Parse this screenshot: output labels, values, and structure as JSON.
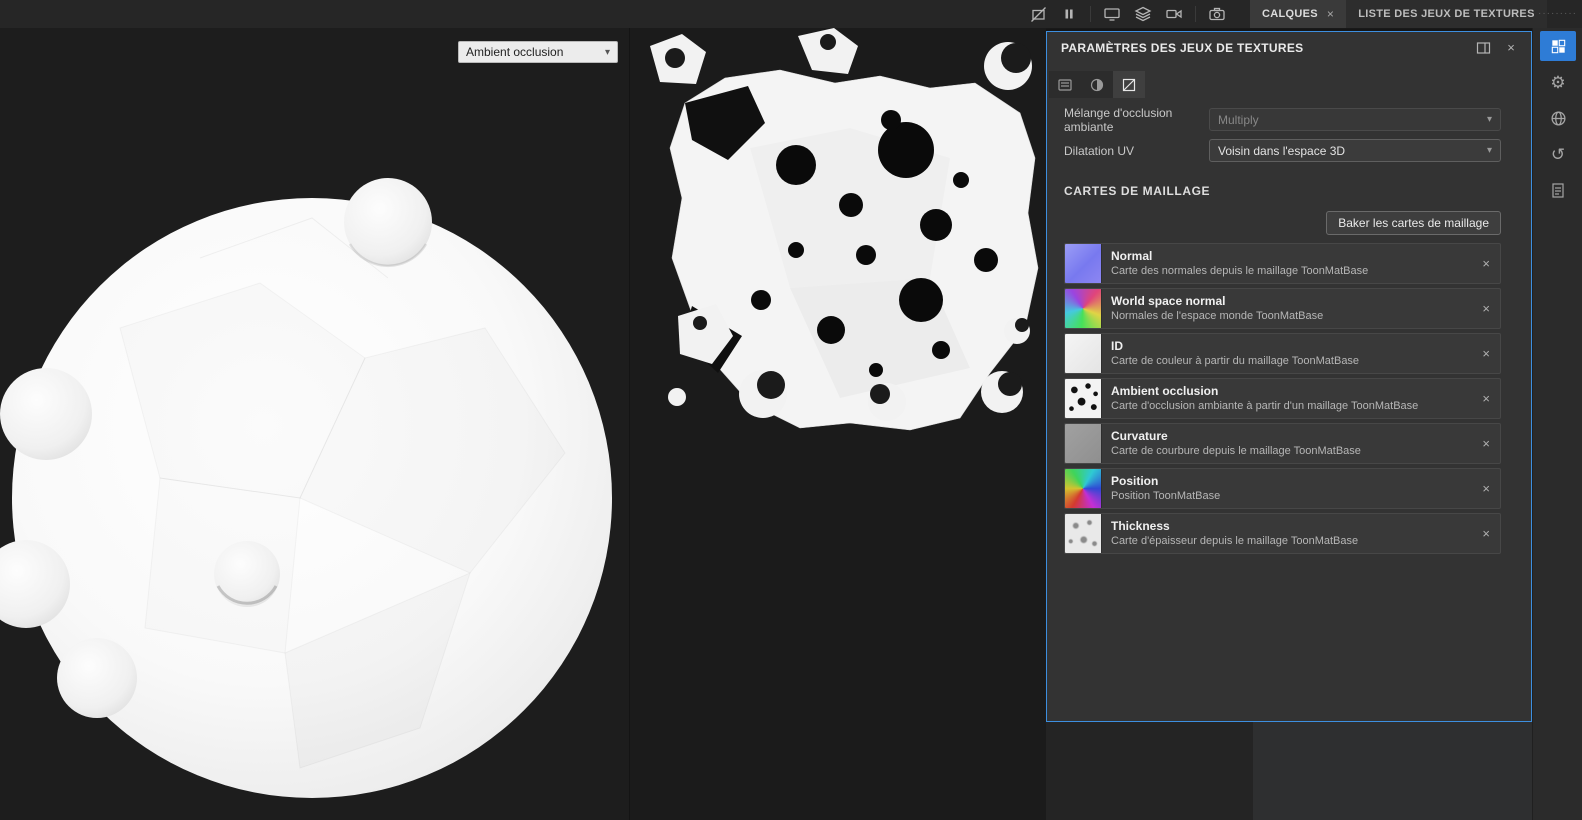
{
  "icons": {
    "close": "×",
    "chevron_down": "▾",
    "gear": "⚙",
    "history": "↺",
    "dots": "·········"
  },
  "topbar": {
    "tabs": [
      {
        "label": "CALQUES"
      },
      {
        "label": "LISTE DES JEUX DE TEXTURES"
      }
    ]
  },
  "viewport_3d": {
    "shader_mode": "Ambient occlusion"
  },
  "panel": {
    "title": "PARAMÈTRES DES JEUX DE TEXTURES",
    "ao_blend_label": "Mélange d'occlusion ambiante",
    "ao_blend_value": "Multiply",
    "uv_dilation_label": "Dilatation UV",
    "uv_dilation_value": "Voisin dans l'espace 3D",
    "section_title": "CARTES DE MAILLAGE",
    "bake_button_label": "Baker les cartes de maillage",
    "mesh_maps": [
      {
        "name": "Normal",
        "description": "Carte des normales depuis le maillage ToonMatBase"
      },
      {
        "name": "World space normal",
        "description": "Normales de l'espace monde ToonMatBase"
      },
      {
        "name": "ID",
        "description": "Carte de couleur à partir du maillage ToonMatBase"
      },
      {
        "name": "Ambient occlusion",
        "description": "Carte d'occlusion ambiante à partir d'un maillage ToonMatBase"
      },
      {
        "name": "Curvature",
        "description": "Carte de courbure depuis le maillage ToonMatBase"
      },
      {
        "name": "Position",
        "description": "Position ToonMatBase"
      },
      {
        "name": "Thickness",
        "description": "Carte d'épaisseur depuis le maillage ToonMatBase"
      }
    ]
  },
  "colors": {
    "accent_blue": "#3d8fe0",
    "panel_bg": "#333333",
    "viewport_bg": "#1d1d1d"
  }
}
